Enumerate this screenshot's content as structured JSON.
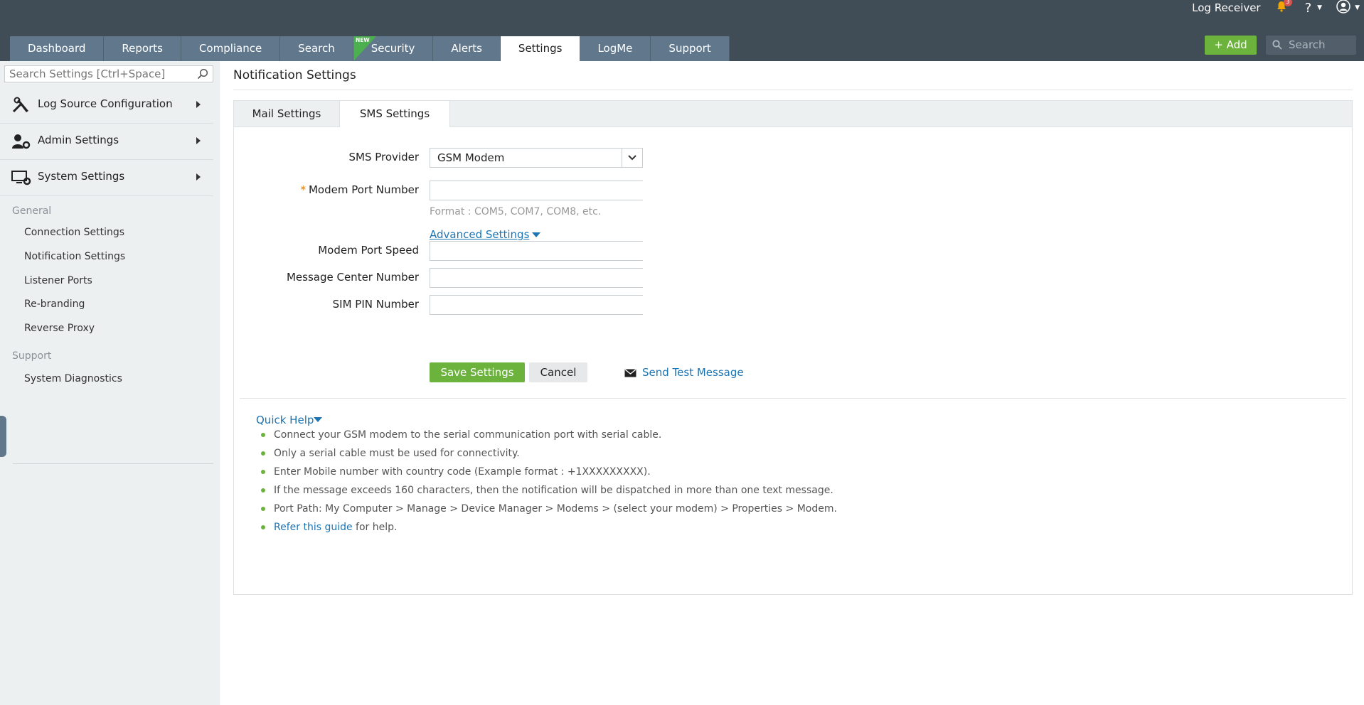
{
  "header": {
    "log_receiver": "Log Receiver",
    "notification_count": "3",
    "help_label": "?",
    "add_label": "Add",
    "search_placeholder": "Search"
  },
  "nav_tabs": [
    {
      "label": "Dashboard"
    },
    {
      "label": "Reports"
    },
    {
      "label": "Compliance"
    },
    {
      "label": "Search"
    },
    {
      "label": "Security",
      "badge": "NEW"
    },
    {
      "label": "Alerts"
    },
    {
      "label": "Settings",
      "active": true
    },
    {
      "label": "LogMe"
    },
    {
      "label": "Support"
    }
  ],
  "sidebar": {
    "search_placeholder": "Search Settings [Ctrl+Space]",
    "categories": [
      {
        "label": "Log Source Configuration",
        "icon": "tools-icon"
      },
      {
        "label": "Admin Settings",
        "icon": "admin-user-icon"
      },
      {
        "label": "System Settings",
        "icon": "monitor-gear-icon"
      }
    ],
    "general_label": "General",
    "general_items": [
      "Connection Settings",
      "Notification Settings",
      "Listener Ports",
      "Re-branding",
      "Reverse Proxy"
    ],
    "support_label": "Support",
    "support_items": [
      "System Diagnostics"
    ]
  },
  "page": {
    "title": "Notification Settings",
    "subtabs": [
      "Mail Settings",
      "SMS Settings"
    ],
    "active_subtab": "SMS Settings"
  },
  "form": {
    "sms_provider_label": "SMS Provider",
    "sms_provider_value": "GSM Modem",
    "modem_port_label": "Modem Port Number",
    "required_mark": "*",
    "modem_port_hint": "Format : COM5, COM7, COM8, etc.",
    "advanced_label": "Advanced Settings",
    "modem_speed_label": "Modem Port Speed",
    "msg_center_label": "Message Center Number",
    "sim_pin_label": "SIM PIN Number",
    "save_label": "Save Settings",
    "cancel_label": "Cancel",
    "send_test_label": "Send Test Message"
  },
  "quick_help": {
    "title": "Quick Help",
    "items": [
      "Connect your GSM modem to the serial communication port with serial cable.",
      "Only a serial cable must be used for connectivity.",
      "Enter Mobile number with country code (Example format : +1XXXXXXXXX).",
      "If the message exceeds 160 characters, then the notification will be dispatched in more than one text message.",
      "Port Path: My Computer > Manage > Device Manager > Modems > (select your modem) > Properties > Modem."
    ],
    "guide_link": "Refer this guide",
    "guide_suffix": " for help."
  },
  "colors": {
    "topbar": "#404c56",
    "tab": "#61788c",
    "accent_green": "#6cb33e",
    "link_blue": "#1b74b3",
    "sidebar_bg": "#edf0f1"
  }
}
